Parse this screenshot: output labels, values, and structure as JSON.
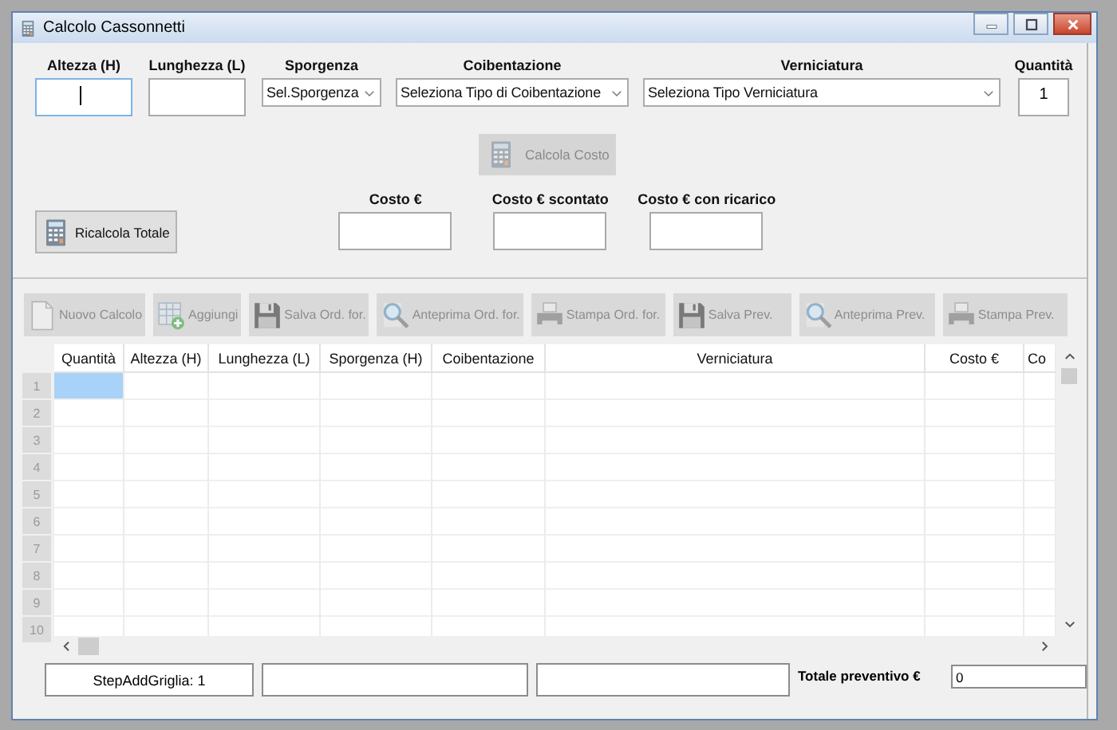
{
  "window": {
    "title": "Calcolo Cassonnetti"
  },
  "fields": [
    {
      "kind": "text",
      "label": "Altezza (H)",
      "focused": true
    },
    {
      "kind": "text",
      "label": "Lunghezza (L)",
      "focused": false
    },
    {
      "kind": "select",
      "label": "Sporgenza",
      "value": "Sel.Sporgenza"
    },
    {
      "kind": "select",
      "label": "Coibentazione",
      "value": "Seleziona Tipo di Coibentazione"
    },
    {
      "kind": "select",
      "label": "Verniciatura",
      "value": "Seleziona Tipo Verniciatura"
    },
    {
      "kind": "text",
      "label": "Quantità",
      "value": "1",
      "focused": false
    }
  ],
  "calc_button": {
    "label": "Calcola Costo",
    "disabled": true
  },
  "recalc_button": {
    "label": "Ricalcola Totale",
    "disabled": false
  },
  "cost_fields": [
    {
      "label": "Costo €"
    },
    {
      "label": "Costo € scontato"
    },
    {
      "label": "Costo € con ricarico"
    }
  ],
  "toolbar": [
    {
      "label": "Nuovo Calcolo",
      "kind": "document",
      "disabled": true
    },
    {
      "label": "Aggiungi",
      "kind": "add",
      "disabled": true
    },
    {
      "label": "Salva Ord. for.",
      "kind": "save",
      "disabled": true
    },
    {
      "label": "Anteprima Ord. for.",
      "kind": "preview",
      "disabled": true
    },
    {
      "label": "Stampa Ord. for.",
      "kind": "print",
      "disabled": true
    },
    {
      "label": "Salva Prev.",
      "kind": "save",
      "disabled": true
    },
    {
      "label": "Anteprima Prev.",
      "kind": "preview",
      "disabled": true
    },
    {
      "label": "Stampa Prev.",
      "kind": "print",
      "disabled": true
    }
  ],
  "grid": {
    "columns": [
      "Quantità",
      "Altezza (H)",
      "Lunghezza (L)",
      "Sporgenza (H)",
      "Coibentazione",
      "Verniciatura",
      "Costo €",
      "Co"
    ],
    "rows": [
      {
        "number": "1",
        "selected": true
      },
      {
        "number": "2",
        "selected": false
      },
      {
        "number": "3",
        "selected": false
      },
      {
        "number": "4",
        "selected": false
      },
      {
        "number": "5",
        "selected": false
      },
      {
        "number": "6",
        "selected": false
      },
      {
        "number": "7",
        "selected": false
      },
      {
        "number": "8",
        "selected": false
      },
      {
        "number": "9",
        "selected": false
      },
      {
        "number": "10",
        "selected": false
      }
    ]
  },
  "status_bar": {
    "panels": [
      "StepAddGriglia: 1"
    ],
    "total_label": "Totale preventivo €",
    "total_value": "0"
  }
}
